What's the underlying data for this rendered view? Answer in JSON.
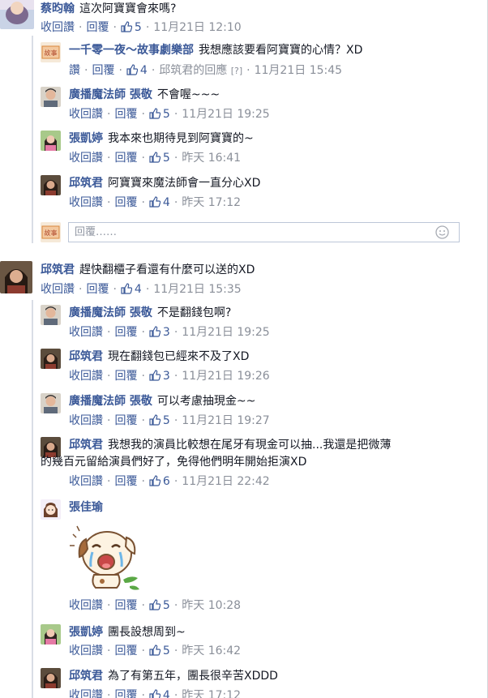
{
  "colors": {
    "author": "#3b5998",
    "link": "#3b5998",
    "meta": "#8a8f99",
    "text": "#141823",
    "rule": "#d9dde6"
  },
  "actions": {
    "unlike": "收回讚",
    "reply": "回覆",
    "dot": "·",
    "truncated_unlike": "讚"
  },
  "reply_note": {
    "text": "邱筑君的回應",
    "help": "[?]"
  },
  "reply_box": {
    "placeholder": "回覆……"
  },
  "top_comment": {
    "author": "蔡昀翰",
    "text": "這次阿寶寶會來嗎?",
    "likes": "5",
    "time": "11月21日 12:10"
  },
  "thread1": [
    {
      "author": "一千零一夜～故事劇樂部",
      "text": "我想應該要看阿寶寶的心情？XD",
      "likes": "4",
      "time": "11月21日 15:45",
      "avatar": "theater-logo"
    },
    {
      "author": "廣播魔法師 張敬",
      "text": "不會喔~~~",
      "likes": "5",
      "time": "11月21日 19:25",
      "avatar": "man-photo"
    },
    {
      "author": "張凱婷",
      "text": "我本來也期待見到阿寶寶的~",
      "likes": "5",
      "time": "昨天 16:41",
      "avatar": "woman-photo"
    },
    {
      "author": "邱筑君",
      "text": "阿寶寶來魔法師會一直分心XD",
      "likes": "4",
      "time": "昨天 17:12",
      "avatar": "woman2-photo"
    }
  ],
  "second_comment": {
    "author": "邱筑君",
    "text": "趕快翻櫃子看還有什麼可以送的XD",
    "likes": "4",
    "time": "11月21日 15:35"
  },
  "thread2": [
    {
      "author": "廣播魔法師 張敬",
      "text": "不是翻錢包啊?",
      "likes": "3",
      "time": "11月21日 19:25",
      "avatar": "man-photo"
    },
    {
      "author": "邱筑君",
      "text": "現在翻錢包已經來不及了XD",
      "likes": "3",
      "time": "11月21日 19:26",
      "avatar": "woman2-photo"
    },
    {
      "author": "廣播魔法師 張敬",
      "text": "可以考慮抽現金~~",
      "likes": "5",
      "time": "11月21日 19:27",
      "avatar": "man-photo"
    },
    {
      "author": "邱筑君",
      "text": "我想我的演員比較想在尾牙有現金可以抽...我還是把微薄",
      "text2": "的幾百元留給演員們好了，免得他們明年開始拒演XD",
      "likes": "6",
      "time": "11月21日 22:42",
      "avatar": "woman2-photo"
    },
    {
      "author": "張佳瑜",
      "text": "",
      "likes": "5",
      "time": "昨天 10:28",
      "avatar": "girl-cartoon",
      "sticker": "crying-dog-sticker"
    },
    {
      "author": "張凱婷",
      "text": "團長設想周到~",
      "likes": "5",
      "time": "昨天 16:42",
      "avatar": "woman-photo"
    },
    {
      "author": "邱筑君",
      "text": "為了有第五年，團長很辛苦XDDD",
      "likes": "4",
      "time": "昨天 17:12",
      "avatar": "woman2-photo"
    }
  ]
}
